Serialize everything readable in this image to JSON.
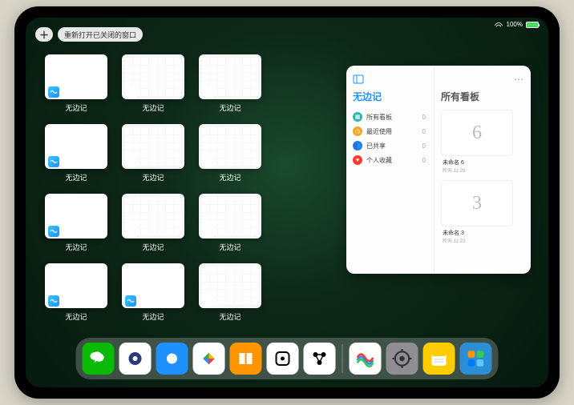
{
  "status": {
    "battery": "100%"
  },
  "topbar": {
    "plus": "＋",
    "reopen_label": "重新打开已关闭的窗口"
  },
  "thumbnails": {
    "app_label": "无边记"
  },
  "panel": {
    "left_title": "无边记",
    "right_title": "所有看板",
    "menu": [
      {
        "label": "所有看板",
        "count": "0"
      },
      {
        "label": "最近使用",
        "count": "0"
      },
      {
        "label": "已共享",
        "count": "0"
      },
      {
        "label": "个人收藏",
        "count": "0"
      }
    ],
    "boards": [
      {
        "glyph": "6",
        "title": "未命名 6",
        "time": "昨天 11:28"
      },
      {
        "glyph": "3",
        "title": "未命名 3",
        "time": "昨天 11:23"
      }
    ]
  },
  "dock": [
    {
      "name": "wechat",
      "bg": "#09bb07"
    },
    {
      "name": "quark",
      "bg": "#ffffff"
    },
    {
      "name": "browser",
      "bg": "#1e90ff"
    },
    {
      "name": "play",
      "bg": "#ffffff"
    },
    {
      "name": "books",
      "bg": "#ff9500"
    },
    {
      "name": "dice",
      "bg": "#ffffff"
    },
    {
      "name": "nodes",
      "bg": "#ffffff"
    },
    {
      "name": "freeform",
      "bg": "#ffffff"
    },
    {
      "name": "settings",
      "bg": "#8e8e93"
    },
    {
      "name": "notes",
      "bg": "#ffcc00"
    },
    {
      "name": "widget",
      "bg": "#2c8fd6"
    }
  ]
}
